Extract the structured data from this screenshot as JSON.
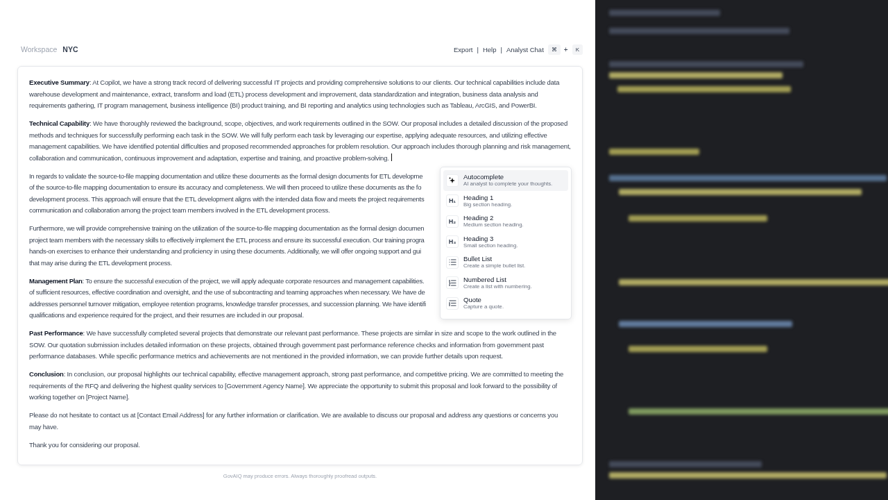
{
  "header": {
    "workspace_label": "Workspace",
    "workspace_name": "NYC",
    "links": [
      "Export",
      "Help",
      "Analyst Chat"
    ],
    "separators": [
      "|",
      "|"
    ],
    "shortcut": {
      "keys": [
        "⌘",
        "K"
      ],
      "joiner": "+"
    }
  },
  "document": {
    "paragraphs": [
      {
        "text": "**Executive Summary**: At Copilot, we have a strong track record of delivering successful IT projects and providing comprehensive solutions to our clients. Our technical capabilities include data warehouse development and maintenance, extract, transform and load (ETL) process development and improvement, data standardization and integration, business data analysis and requirements gathering, IT program management, business intelligence (BI) product training, and BI reporting and analytics using technologies such as Tableau, ArcGIS, and PowerBI.",
        "cursor": false
      },
      {
        "text": "**Technical Capability**: We have thoroughly reviewed the background, scope, objectives, and work requirements outlined in the SOW. Our proposal includes a detailed discussion of the proposed methods and techniques for successfully performing each task in the SOW. We will fully perform each task by leveraging our expertise, applying adequate resources, and utilizing effective management capabilities. We have identified potential difficulties and proposed recommended approaches for problem resolution. Our approach includes thorough planning and risk management, collaboration and communication, continuous improvement and adaptation, expertise and training, and proactive problem-solving.",
        "cursor": true
      },
      {
        "lines": [
          "In regards to validate the source-to-file mapping documentation and utilize these documents as the formal design documents for ETL developme",
          "of the source-to-file mapping documentation to ensure its accuracy and completeness. We will then proceed to utilize these documents as the fo",
          "development process. This approach will ensure that the ETL development aligns with the intended data flow and meets the project requirements",
          "communication and collaboration among the project team members involved in the ETL development process."
        ],
        "cursor": false
      },
      {
        "lines": [
          "Furthermore, we will provide comprehensive training on the utilization of the source-to-file mapping documentation as the formal design documen",
          "project team members with the necessary skills to effectively implement the ETL process and ensure its successful execution. Our training progra",
          "hands-on exercises to enhance their understanding and proficiency in using these documents. Additionally, we will offer ongoing support and gui",
          "that may arise during the ETL development process."
        ],
        "cursor": false
      },
      {
        "lines": [
          "**Management Plan**: To ensure the successful execution of the project, we will apply adequate corporate resources and management capabilities.",
          "of sufficient resources, effective coordination and oversight, and the use of subcontracting and teaming approaches when necessary. We have de",
          "addresses personnel turnover mitigation, employee retention programs, knowledge transfer processes, and succession planning. We have identifi",
          "qualifications and experience required for the project, and their resumes are included in our proposal."
        ],
        "cursor": false
      },
      {
        "text": "**Past Performance**: We have successfully completed several projects that demonstrate our relevant past performance. These projects are similar in size and scope to the work outlined in the SOW. Our quotation submission includes detailed information on these projects, obtained through government past performance reference checks and information from government past performance databases. While specific performance metrics and achievements are not mentioned in the provided information, we can provide further details upon request.",
        "cursor": false
      },
      {
        "text": "**Conclusion**: In conclusion, our proposal highlights our technical capability, effective management approach, strong past performance, and competitive pricing. We are committed to meeting the requirements of the RFQ and delivering the highest quality services to [Government Agency Name]. We appreciate the opportunity to submit this proposal and look forward to the possibility of working together on [Project Name].",
        "cursor": false
      },
      {
        "text": "Please do not hesitate to contact us at [Contact Email Address] for any further information or clarification. We are available to discuss our proposal and address any questions or concerns you may have.",
        "cursor": false
      },
      {
        "text": "Thank you for considering our proposal.",
        "cursor": false
      }
    ]
  },
  "command_menu": {
    "items": [
      {
        "kind": "sparkle",
        "title": "Autocomplete",
        "description": "AI analyst to complete your thoughts.",
        "selected": true
      },
      {
        "kind": "glyph",
        "glyph": "H₁",
        "title": "Heading 1",
        "description": "Big section heading.",
        "selected": false
      },
      {
        "kind": "glyph",
        "glyph": "H₂",
        "title": "Heading 2",
        "description": "Medium section heading.",
        "selected": false
      },
      {
        "kind": "glyph",
        "glyph": "H₃",
        "title": "Heading 3",
        "description": "Small section heading.",
        "selected": false
      },
      {
        "kind": "bullets",
        "title": "Bullet List",
        "description": "Create a simple bullet list.",
        "selected": false
      },
      {
        "kind": "numbers",
        "title": "Numbered List",
        "description": "Create a list with numbering.",
        "selected": false
      },
      {
        "kind": "quote",
        "title": "Quote",
        "description": "Capture a quote.",
        "selected": false
      }
    ]
  },
  "footer": {
    "disclaimer": "GovAIQ may produce errors. Always thoroughly proofread outputs."
  }
}
